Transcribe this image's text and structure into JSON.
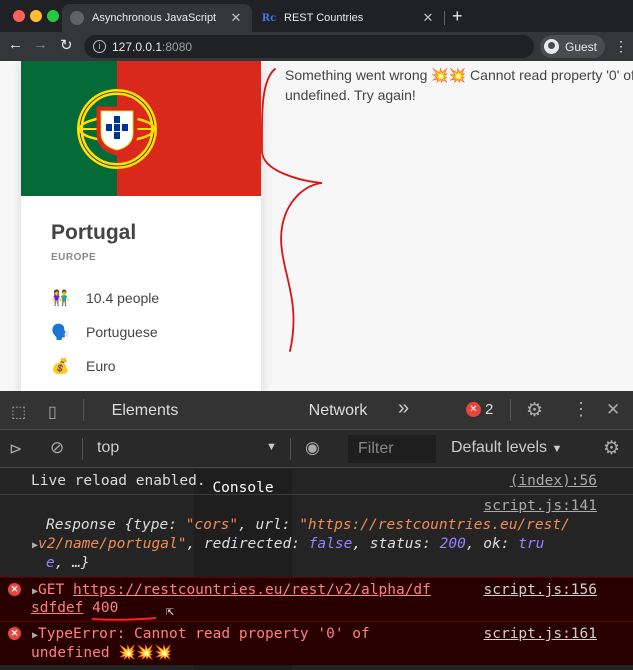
{
  "browser": {
    "tabs": [
      {
        "title": "Asynchronous JavaScript",
        "favicon": "globe-icon",
        "active": true
      },
      {
        "title": "REST Countries",
        "favicon": "Rc",
        "active": false
      }
    ],
    "url_host": "127.0.0.1",
    "url_port": ":8080",
    "profile_label": "Guest"
  },
  "page": {
    "country": {
      "name": "Portugal",
      "region": "EUROPE",
      "population": "10.4 people",
      "language": "Portuguese",
      "currency": "Euro",
      "icons": {
        "population": "👫",
        "language": "🗣️",
        "currency": "💰"
      },
      "flag_colors": {
        "green": "#046a38",
        "red": "#da291c",
        "gold": "#ffe000"
      }
    },
    "error_message": "Something went wrong 💥💥 Cannot read property '0' of undefined. Try again!"
  },
  "devtools": {
    "tabs": {
      "elements": "Elements",
      "console": "Console",
      "network": "Network"
    },
    "error_count": "2",
    "context": "top",
    "filter_placeholder": "Filter",
    "levels": "Default levels",
    "messages": {
      "m1": {
        "text": "Live reload enabled.",
        "source": "(index):56"
      },
      "m2": {
        "source": "script.js:141",
        "type_name": "Response",
        "type_value": "\"cors\"",
        "url_line1": "\"https://restcountries.eu/rest/",
        "url_line2": "v2/name/portugal\"",
        "redirected": "false",
        "status": "200",
        "ok_part1": "tru",
        "ok_part2": "e",
        "ellipsis": "…}"
      },
      "m3": {
        "method": "GET",
        "url_line1": "https://restcountries.eu/rest/v2/alpha/df",
        "url_line2": "sdfdef",
        "code": "400",
        "source": "script.js:156"
      },
      "m4": {
        "line1": "TypeError: Cannot read property '0' of",
        "line2": "undefined 💥💥💥",
        "source": "script.js:161"
      }
    }
  }
}
